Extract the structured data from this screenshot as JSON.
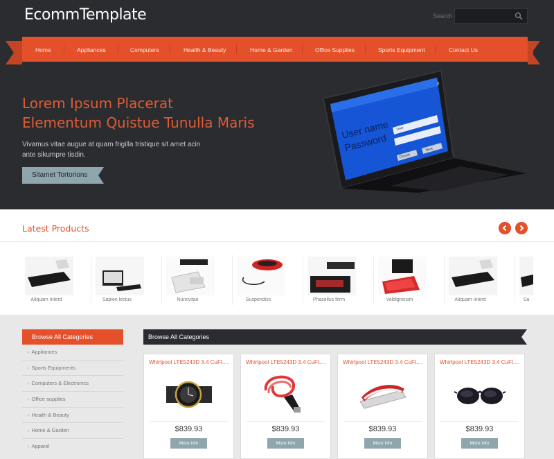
{
  "brand": {
    "logo": "EcommTemplate",
    "accent": "#e3502a",
    "dark": "#2a2c30"
  },
  "search": {
    "label": "Search",
    "placeholder": "",
    "icon": "search-icon"
  },
  "nav": {
    "items": [
      "Home",
      "Appliances",
      "Computers",
      "Health & Beauty",
      "Home & Garden",
      "Office Supplies",
      "Sports Equipment",
      "Contact Us"
    ]
  },
  "hero": {
    "title_line1": "Lorem Ipsum Placerat",
    "title_line2": "Elementum Quistue Tunulla Maris",
    "text": "Vivamus vitae augue at quam frigilla tristique sit amet acin ante sikumpre tisdin.",
    "button": "Sitamet Tortorions",
    "screen_text": {
      "username": "User name",
      "password": "Password",
      "user_field": "User",
      "cancel": "Cancel",
      "next": "Next",
      "close": "X"
    }
  },
  "latest": {
    "title": "Latest Products",
    "prev_icon": "chevron-left-icon",
    "next_icon": "chevron-right-icon",
    "items": [
      "Aliquam Interd",
      "Sapien lectus",
      "Nuncvitae",
      "Suspendiss",
      "Phasellus ferm",
      "Veldignissim",
      "Aliquam Interd",
      "Sa"
    ]
  },
  "sidebar": {
    "title": "Browse All Categories",
    "items": [
      "Appliances",
      "Sports Equipments",
      "Computers & Electronics",
      "Office supplies",
      "Health & Beauty",
      "Home & Garden",
      "Apparel"
    ]
  },
  "main": {
    "title": "Browse All Categories",
    "cards": [
      {
        "title": "Whirlpool LTE5243D 3.4 CuFt....",
        "price": "$839.93",
        "button": "More Info",
        "image": "watch"
      },
      {
        "title": "Whirlpool LTE5243D 3.4 CuFt....",
        "price": "$839.93",
        "button": "More Info",
        "image": "usb-cable"
      },
      {
        "title": "Whirlpool LTE5243D 3.4 CuFt....",
        "price": "$839.93",
        "button": "More Info",
        "image": "stapler"
      },
      {
        "title": "Whirlpool LTE5243D 3.4 CuFt....",
        "price": "$839.93",
        "button": "More Info",
        "image": "sunglasses"
      }
    ]
  }
}
